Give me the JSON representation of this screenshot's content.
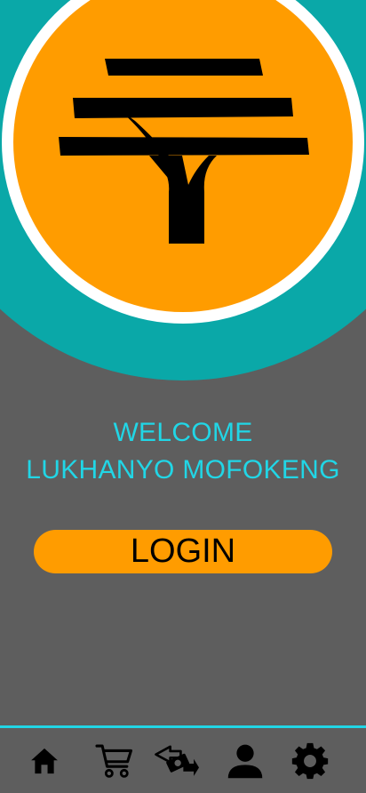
{
  "brand": {
    "logo_icon": "tree-logo-icon",
    "colors": {
      "teal": "#0aa8a8",
      "orange": "#ff9c00",
      "cyan_text": "#21d6e6",
      "background": "#5e5e5e"
    }
  },
  "welcome": {
    "line1": "WELCOME",
    "line2": "LUKHANYO MOFOKENG"
  },
  "login": {
    "label": "LOGIN"
  },
  "nav": {
    "items": [
      {
        "icon": "home-icon"
      },
      {
        "icon": "cart-icon"
      },
      {
        "icon": "money-transfer-icon"
      },
      {
        "icon": "person-icon"
      },
      {
        "icon": "gear-icon"
      }
    ]
  }
}
